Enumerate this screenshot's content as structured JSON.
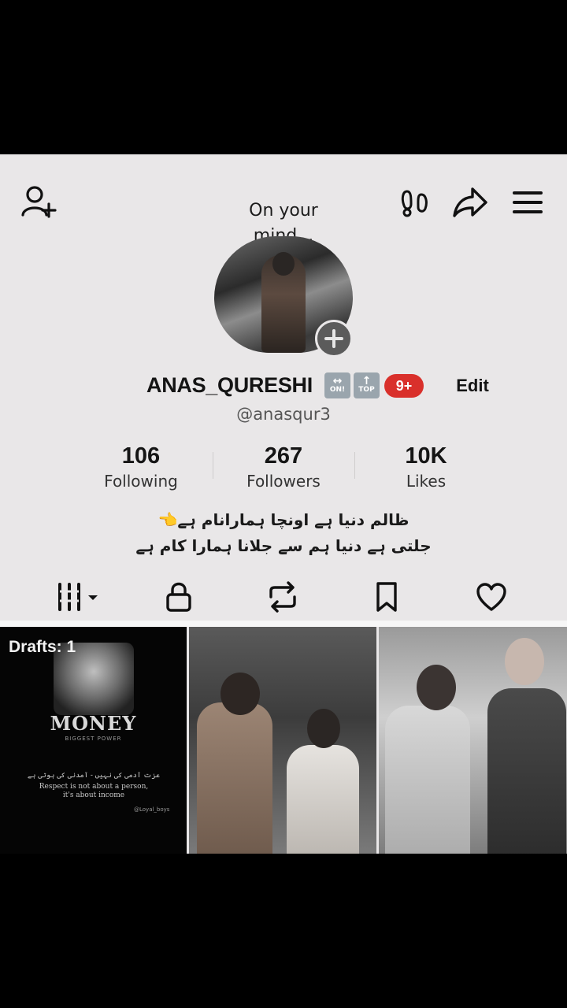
{
  "header": {
    "mind_note_line1": "On your",
    "mind_note_line2": "mind...",
    "icons": {
      "add_friend": "person-plus-icon",
      "footprints": "footprints-icon",
      "share": "share-arrow-icon",
      "menu": "hamburger-menu-icon"
    }
  },
  "profile": {
    "username": "ANAS_QURESHI",
    "emoji1": "↔",
    "emoji1_caption": "ON!",
    "emoji2": "↑",
    "emoji2_caption": "TOP",
    "notification_badge": "9+",
    "edit_label": "Edit",
    "handle": "@anasqur3"
  },
  "stats": {
    "following": {
      "value": "106",
      "label": "Following"
    },
    "followers": {
      "value": "267",
      "label": "Followers"
    },
    "likes": {
      "value": "10K",
      "label": "Likes"
    }
  },
  "bio": {
    "line1": "ظالم دنیا ہے اونچا ہمارانام ہے👈",
    "line2": "جلتی ہے دنیا ہم سے جلانا ہمارا کام ہے"
  },
  "tabs": {
    "items": [
      "grid-icon",
      "lock-icon",
      "repost-icon",
      "bookmark-icon",
      "heart-icon"
    ],
    "active": 0
  },
  "grid": {
    "drafts_label": "Drafts: 1",
    "money_title": "MONEY",
    "money_subtitle": "BIGGEST POWER",
    "quote_urdu": "عزت آدمی کی نہیں - آمدنی کی ہوتی ہے",
    "quote_en1": "Respect is not about a person,",
    "quote_en2": "it's about income",
    "watermark": "@Loyal_boys"
  },
  "colors": {
    "background": "#e9e7e8",
    "badge": "#d9302b",
    "text": "#141414"
  }
}
